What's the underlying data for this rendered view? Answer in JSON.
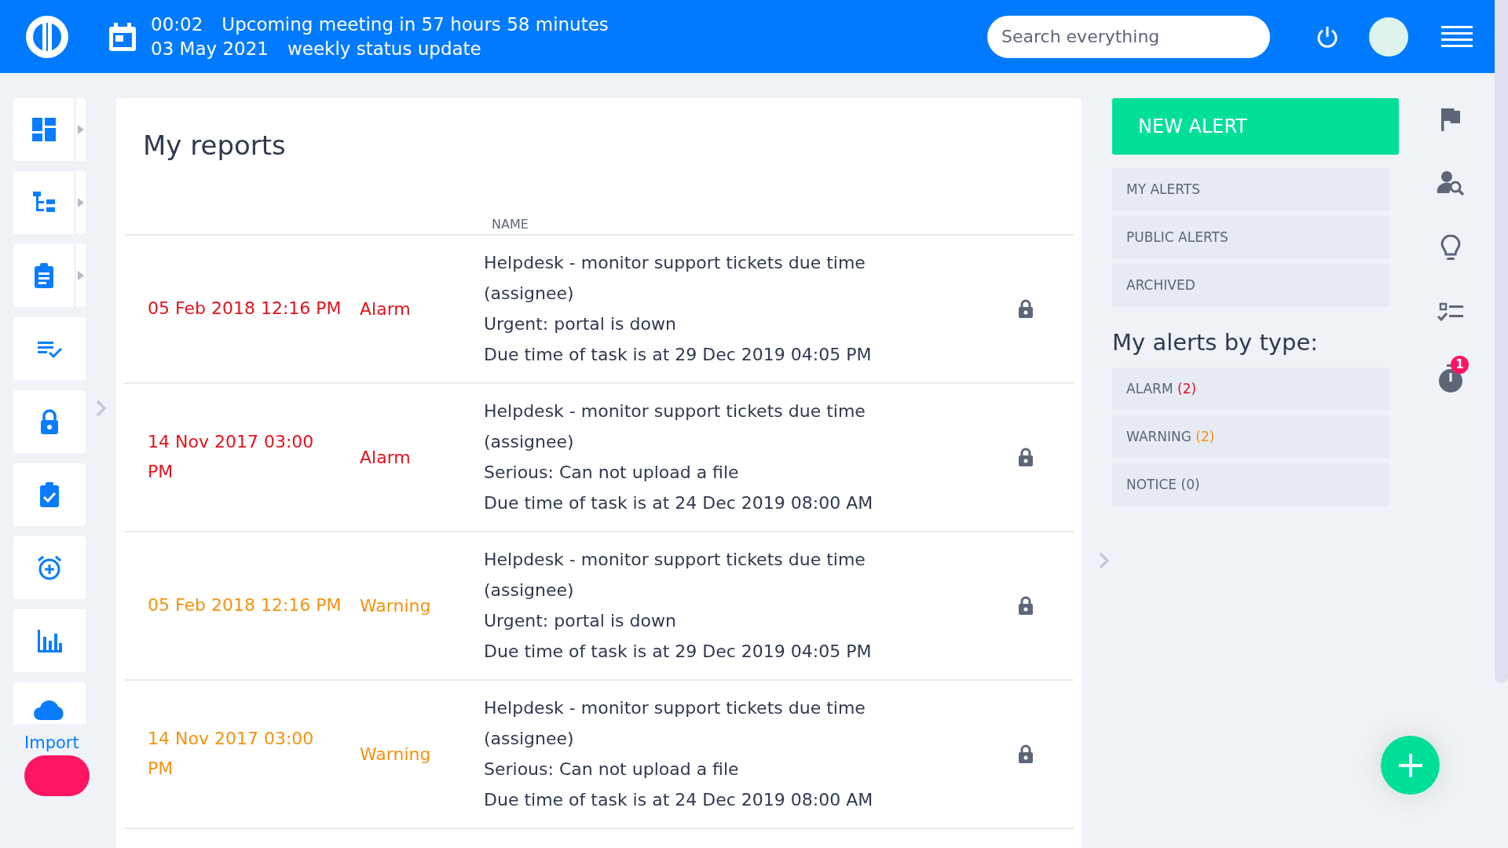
{
  "header": {
    "meeting_time": "00:02",
    "meeting_text": "Upcoming meeting in 57 hours 58 minutes",
    "meeting_date": "03 May 2021",
    "meeting_title": "weekly status update",
    "search": {
      "placeholder": "Search everything"
    }
  },
  "sidebar": {
    "items": [
      {
        "kind": "dashboard",
        "has_submenu": true
      },
      {
        "kind": "tree",
        "has_submenu": true
      },
      {
        "kind": "clipboard",
        "has_submenu": true
      },
      {
        "kind": "checklist",
        "has_submenu": false
      },
      {
        "kind": "lock",
        "has_submenu": false
      },
      {
        "kind": "task",
        "has_submenu": false
      },
      {
        "kind": "alarm",
        "has_submenu": false
      },
      {
        "kind": "chart",
        "has_submenu": false
      }
    ],
    "import_label": "Import"
  },
  "report": {
    "title": "My reports",
    "columns": [
      "NAME"
    ],
    "rows": [
      {
        "kind": "alarm",
        "date": "05 Feb 2018 12:16 PM",
        "type": "Alarm",
        "name_lines": [
          "Helpdesk - monitor support tickets due time (assignee)",
          "Urgent: portal is down",
          "Due time of task is at 29 Dec 2019 04:05 PM"
        ]
      },
      {
        "kind": "alarm",
        "date": "14 Nov 2017 03:00 PM",
        "type": "Alarm",
        "name_lines": [
          "Helpdesk - monitor support tickets due time (assignee)",
          "Serious: Can not upload a file",
          "Due time of task is at 24 Dec 2019 08:00 AM"
        ]
      },
      {
        "kind": "warning",
        "date": "05 Feb 2018 12:16 PM",
        "type": "Warning",
        "name_lines": [
          "Helpdesk - monitor support tickets due time (assignee)",
          "Urgent: portal is down",
          "Due time of task is at 29 Dec 2019 04:05 PM"
        ]
      },
      {
        "kind": "warning",
        "date": "14 Nov 2017 03:00 PM",
        "type": "Warning",
        "name_lines": [
          "Helpdesk - monitor support tickets due time (assignee)",
          "Serious: Can not upload a file",
          "Due time of task is at 24 Dec 2019 08:00 AM"
        ]
      }
    ]
  },
  "alerts": {
    "new_button": "NEW ALERT",
    "links": [
      "MY ALERTS",
      "PUBLIC ALERTS",
      "ARCHIVED"
    ],
    "by_type_title": "My alerts by type:",
    "types": [
      {
        "label": "ALARM",
        "count": "(2)",
        "color": "#e0141e"
      },
      {
        "label": "WARNING",
        "count": "(2)",
        "color": "#f39212"
      },
      {
        "label": "NOTICE",
        "count": "(0)",
        "color": "#5d6679"
      }
    ]
  },
  "right_bar": {
    "timer_badge": "1"
  }
}
